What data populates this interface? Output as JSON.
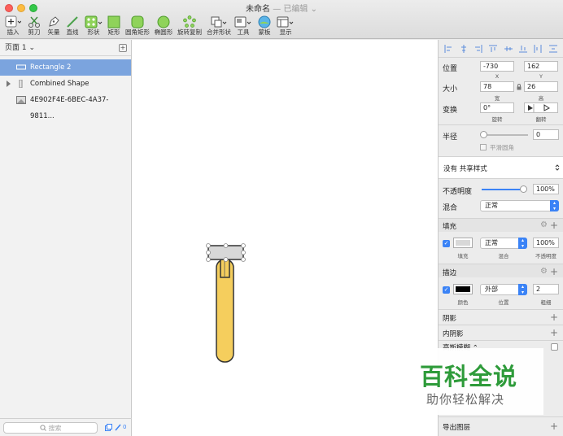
{
  "window": {
    "title": "未命名",
    "edited": "— 已编辑 ⌄"
  },
  "toolbar": [
    {
      "label": "插入",
      "icon": "plus-icon"
    },
    {
      "label": "剪刀",
      "icon": "scissors-icon"
    },
    {
      "label": "矢量",
      "icon": "pen-icon"
    },
    {
      "label": "直线",
      "icon": "line-icon"
    },
    {
      "label": "形状",
      "icon": "shapes-icon"
    },
    {
      "label": "矩形",
      "icon": "rectangle-icon"
    },
    {
      "label": "圆角矩形",
      "icon": "rounded-rectangle-icon"
    },
    {
      "label": "椭圆形",
      "icon": "oval-icon"
    },
    {
      "label": "旋转复制",
      "icon": "rotate-copies-icon"
    },
    {
      "label": "合并形状",
      "icon": "combine-shapes-icon"
    },
    {
      "label": "工具",
      "icon": "tools-icon"
    },
    {
      "label": "蒙板",
      "icon": "mask-icon"
    },
    {
      "label": "显示",
      "icon": "view-icon"
    }
  ],
  "pages": {
    "selected": "页面 1 ⌄",
    "add": "+"
  },
  "layers": [
    {
      "name": "Rectangle 2",
      "selected": true
    },
    {
      "name": "Combined Shape",
      "selected": false
    },
    {
      "name": "4E902F4E-6BEC-4A37-9811...",
      "selected": false
    }
  ],
  "search": {
    "placeholder": "搜索",
    "count": "0"
  },
  "inspector": {
    "position": {
      "label": "位置",
      "x": "-730",
      "y": "162",
      "x_label": "X",
      "y_label": "Y"
    },
    "size": {
      "label": "大小",
      "w": "78",
      "h": "26",
      "w_label": "宽",
      "h_label": "高"
    },
    "transform": {
      "label": "变换",
      "rotate": "0°",
      "rotate_label": "旋转",
      "flip_label": "翻转"
    },
    "radius": {
      "label": "半径",
      "value": "0",
      "smooth_label": "平滑圆角"
    },
    "shared_style": "没有 共享样式",
    "opacity": {
      "label": "不透明度",
      "value": "100%"
    },
    "blend": {
      "label": "混合",
      "value": "正常"
    },
    "fill": {
      "header": "填充",
      "blend": "正常",
      "opacity": "100%",
      "color": "#d8d8d8",
      "sub_fill": "填充",
      "sub_blend": "混合",
      "sub_opacity": "不透明度"
    },
    "border": {
      "header": "描边",
      "position": "外部",
      "width": "2",
      "color": "#000000",
      "sub_color": "颜色",
      "sub_position": "位置",
      "sub_width": "粗细"
    },
    "shadow": "阴影",
    "inner_shadow": "内阴影",
    "blur": "高斯模糊 ⌃",
    "export": "导出图层"
  },
  "canvas": {
    "handle_color": "#f5ce5d",
    "rect_color": "#d8d8d8"
  },
  "watermark": {
    "title": "百科全说",
    "subtitle": "助你轻松解决"
  }
}
